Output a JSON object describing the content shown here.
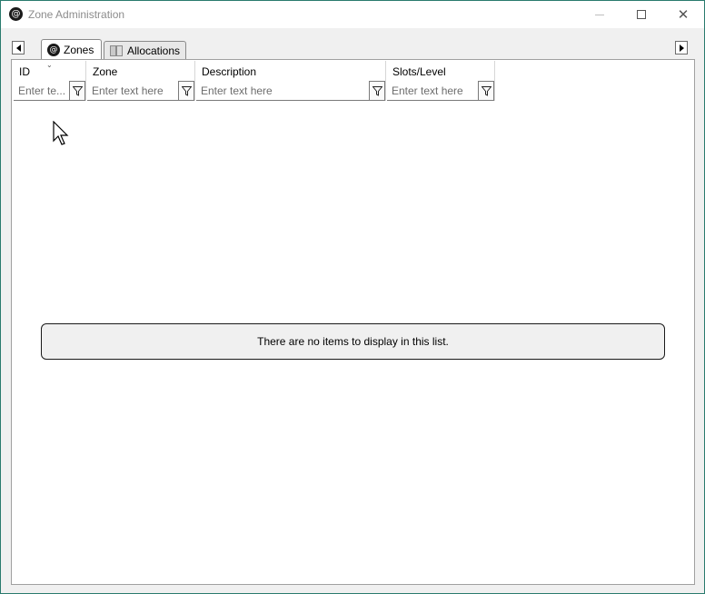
{
  "window": {
    "title": "Zone Administration",
    "app_icon_glyph": "@"
  },
  "tabs": [
    {
      "label": "Zones",
      "icon": "at-sign-icon",
      "active": true
    },
    {
      "label": "Allocations",
      "icon": "book-icon",
      "active": false
    }
  ],
  "grid": {
    "columns": [
      {
        "label": "ID",
        "filter_placeholder": "Enter te..."
      },
      {
        "label": "Zone",
        "filter_placeholder": "Enter text here"
      },
      {
        "label": "Description",
        "filter_placeholder": "Enter text here"
      },
      {
        "label": "Slots/Level",
        "filter_placeholder": "Enter text here"
      }
    ],
    "empty_message": "There are no items to display in this list."
  },
  "colors": {
    "window_border": "#2a7b6e",
    "tab_bg": "#f0f0f0",
    "content_bg": "#ffffff"
  }
}
